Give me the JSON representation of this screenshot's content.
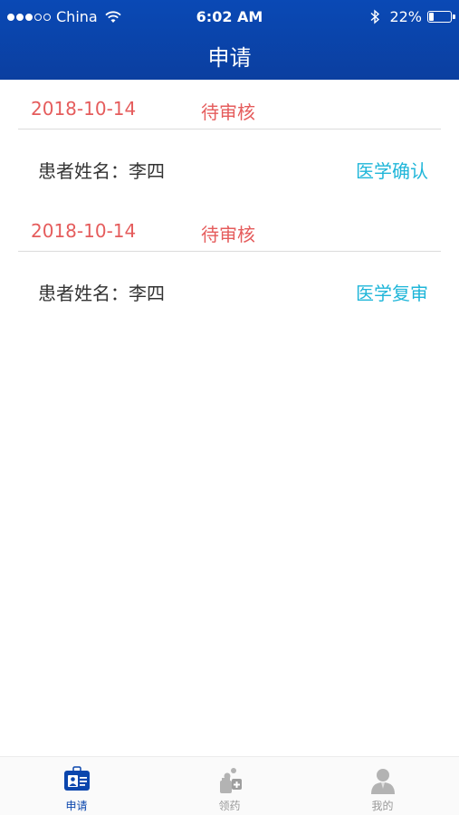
{
  "statusbar": {
    "carrier": "China",
    "time": "6:02 AM",
    "battery": "22%",
    "battery_level": 0.22
  },
  "header": {
    "title": "申请"
  },
  "records": [
    {
      "date": "2018-10-14",
      "status": "待审核",
      "patient": "患者姓名：李四",
      "action": "医学确认"
    },
    {
      "date": "2018-10-14",
      "status": "待审核",
      "patient": "患者姓名：李四",
      "action": "医学复审"
    }
  ],
  "tabbar": {
    "items": [
      {
        "label": "申请",
        "icon": "id-card-icon",
        "active": true
      },
      {
        "label": "领药",
        "icon": "medicine-icon",
        "active": false
      },
      {
        "label": "我的",
        "icon": "user-icon",
        "active": false
      }
    ]
  },
  "colors": {
    "header": "#0b46ad",
    "status": "#e55c5c",
    "action": "#1fb6d9",
    "tab_active": "#0b46ad",
    "tab_inactive": "#999999"
  }
}
